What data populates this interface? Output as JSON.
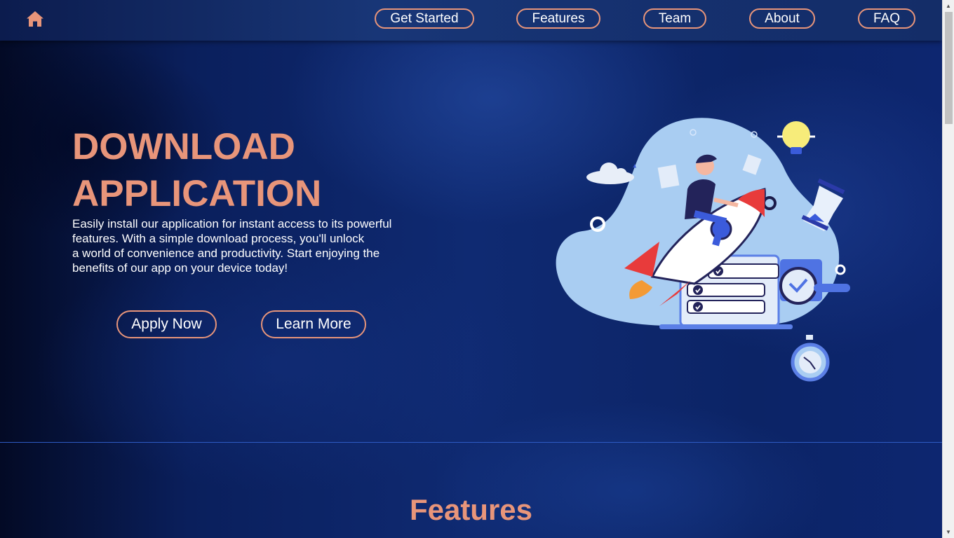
{
  "navbar": {
    "home_icon": "home-icon",
    "links": [
      "Get Started",
      "Features",
      "Team",
      "About",
      "FAQ"
    ]
  },
  "hero": {
    "title_line1": "DOWNLOAD",
    "title_line2": "APPLICATION",
    "description_lines": [
      "Easily install our application for instant access to its powerful",
      "features. With a simple download process, you'll unlock",
      "a world of convenience and productivity. Start enjoying the",
      "benefits of our app on your device today!"
    ],
    "apply_label": "Apply Now",
    "learn_label": "Learn More",
    "illustration": "rocket-launch-illustration"
  },
  "features_section": {
    "title": "Features"
  },
  "colors": {
    "accent": "#e8957a",
    "background": "#0f2a72",
    "navbar": "#15306e",
    "text": "#ffffff"
  }
}
